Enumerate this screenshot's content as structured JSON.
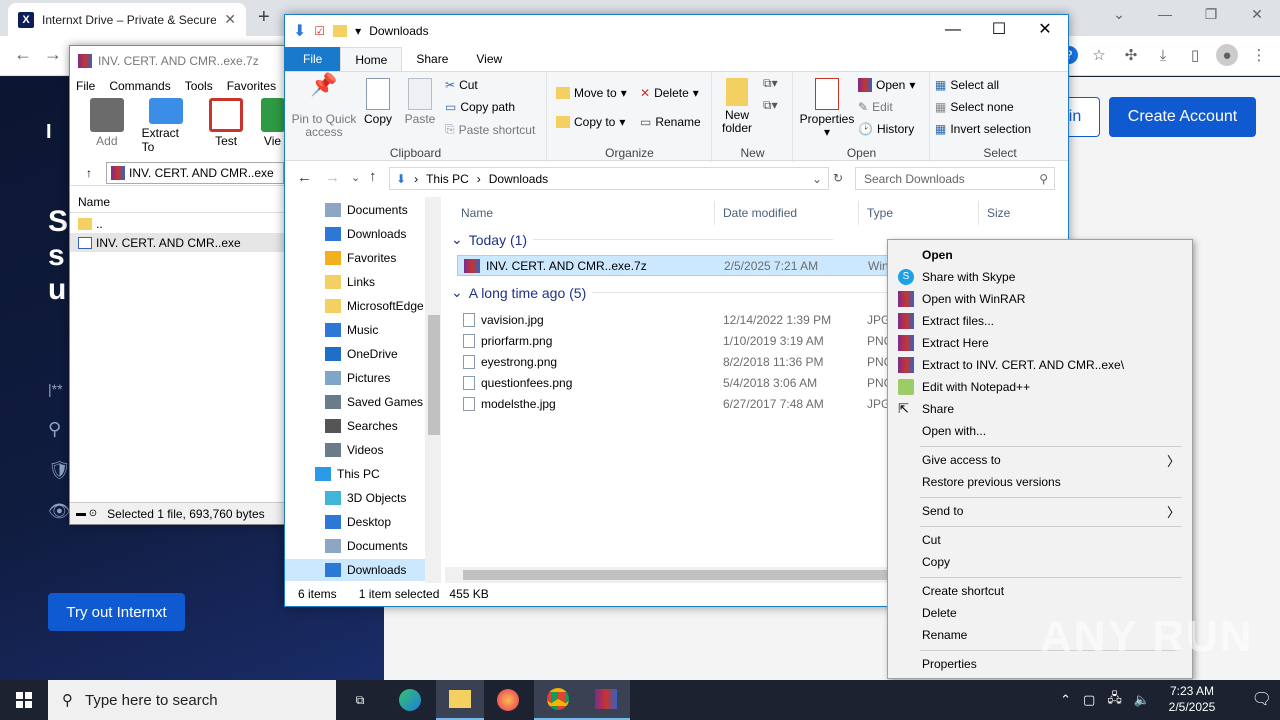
{
  "chrome": {
    "tab_title": "Internxt Drive – Private & Secure",
    "favicon_letter": "X",
    "new_tab": "+",
    "window_controls": [
      "⌄",
      "—",
      "❐",
      "✕"
    ]
  },
  "site": {
    "heading_letters": [
      "S",
      "s",
      "u"
    ],
    "logo_letters": "I N",
    "login_label": "in",
    "create_account": "Create Account",
    "try_button": "Try out Internxt",
    "sidebar_marks": [
      "|**",
      "⚲",
      "🛡",
      "👁"
    ]
  },
  "winrar": {
    "title": "INV. CERT. AND CMR..exe.7z",
    "menu": [
      "File",
      "Commands",
      "Tools",
      "Favorites"
    ],
    "tools": [
      {
        "label": "Add",
        "icon": "add-icon",
        "color": "#6b6b6b"
      },
      {
        "label": "Extract To",
        "icon": "extract-to-icon",
        "color": "#3a8ee8"
      },
      {
        "label": "Test",
        "icon": "test-icon",
        "color": "#c9342c"
      },
      {
        "label": "Vie",
        "icon": "view-icon",
        "color": "#2f9a44"
      }
    ],
    "path": "INV. CERT. AND CMR..exe",
    "column_name": "Name",
    "rows": [
      {
        "name": ".."
      },
      {
        "name": "INV. CERT. AND CMR..exe"
      }
    ],
    "status": "Selected 1 file, 693,760 bytes"
  },
  "explorer": {
    "title": "Downloads",
    "tabs": {
      "file": "File",
      "home": "Home",
      "share": "Share",
      "view": "View"
    },
    "clipboard": {
      "pin": "Pin to Quick access",
      "copy": "Copy",
      "paste": "Paste",
      "cut": "Cut",
      "copy_path": "Copy path",
      "paste_shortcut": "Paste shortcut",
      "label": "Clipboard"
    },
    "organize": {
      "move_to": "Move to",
      "copy_to": "Copy to",
      "delete": "Delete",
      "rename": "Rename",
      "label": "Organize"
    },
    "new_group": {
      "new_folder": "New folder",
      "label": "New"
    },
    "open_group": {
      "properties": "Properties",
      "open": "Open",
      "edit": "Edit",
      "history": "History",
      "label": "Open"
    },
    "select_group": {
      "select_all": "Select all",
      "select_none": "Select none",
      "invert": "Invert selection",
      "label": "Select"
    },
    "address": {
      "root": "This PC",
      "folder": "Downloads"
    },
    "search_placeholder": "Search Downloads",
    "nav_items": [
      {
        "label": "Documents",
        "icon": "documents-icon"
      },
      {
        "label": "Downloads",
        "icon": "downloads-icon"
      },
      {
        "label": "Favorites",
        "icon": "favorites-icon"
      },
      {
        "label": "Links",
        "icon": "links-icon"
      },
      {
        "label": "MicrosoftEdge",
        "icon": "folder-icon"
      },
      {
        "label": "Music",
        "icon": "music-icon"
      },
      {
        "label": "OneDrive",
        "icon": "onedrive-icon"
      },
      {
        "label": "Pictures",
        "icon": "pictures-icon"
      },
      {
        "label": "Saved Games",
        "icon": "saved-games-icon"
      },
      {
        "label": "Searches",
        "icon": "searches-icon"
      },
      {
        "label": "Videos",
        "icon": "videos-icon"
      },
      {
        "label": "This PC",
        "icon": "this-pc-icon"
      },
      {
        "label": "3D Objects",
        "icon": "3d-objects-icon"
      },
      {
        "label": "Desktop",
        "icon": "desktop-icon"
      },
      {
        "label": "Documents",
        "icon": "documents-icon"
      },
      {
        "label": "Downloads",
        "icon": "downloads-icon"
      }
    ],
    "columns": {
      "name": "Name",
      "date": "Date modified",
      "type": "Type",
      "size": "Size"
    },
    "groups": {
      "today": "Today (1)",
      "older": "A long time ago (5)"
    },
    "files_today": [
      {
        "name": "INV. CERT. AND CMR..exe.7z",
        "date": "2/5/2025 7:21 AM",
        "type": "Win"
      }
    ],
    "files_older": [
      {
        "name": "vavision.jpg",
        "date": "12/14/2022 1:39 PM",
        "type": "JPG"
      },
      {
        "name": "priorfarm.png",
        "date": "1/10/2019 3:19 AM",
        "type": "PNG"
      },
      {
        "name": "eyestrong.png",
        "date": "8/2/2018 11:36 PM",
        "type": "PNG"
      },
      {
        "name": "questionfees.png",
        "date": "5/4/2018 3:06 AM",
        "type": "PNG"
      },
      {
        "name": "modelsthe.jpg",
        "date": "6/27/2017 7:48 AM",
        "type": "JPG"
      }
    ],
    "status": {
      "count": "6 items",
      "selected": "1 item selected",
      "size": "455 KB"
    }
  },
  "context_menu": {
    "open": "Open",
    "share_skype": "Share with Skype",
    "open_winrar": "Open with WinRAR",
    "extract_files": "Extract files...",
    "extract_here": "Extract Here",
    "extract_to": "Extract to INV. CERT. AND CMR..exe\\",
    "edit_notepad": "Edit with Notepad++",
    "share": "Share",
    "open_with": "Open with...",
    "give_access": "Give access to",
    "restore": "Restore previous versions",
    "send_to": "Send to",
    "cut": "Cut",
    "copy": "Copy",
    "create_shortcut": "Create shortcut",
    "delete": "Delete",
    "rename": "Rename",
    "properties": "Properties"
  },
  "taskbar": {
    "search_placeholder": "Type here to search",
    "time": "7:23 AM",
    "date": "2/5/2025"
  },
  "watermark": "ANY RUN"
}
